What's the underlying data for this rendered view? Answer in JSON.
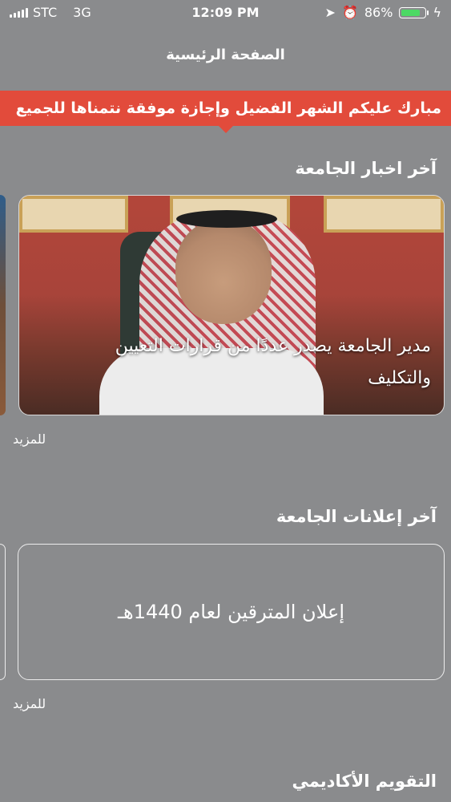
{
  "status_bar": {
    "carrier": "STC",
    "network": "3G",
    "time": "12:09 PM",
    "battery_percent": "86%",
    "battery_level": 0.86,
    "battery_color": "#4cd964"
  },
  "nav": {
    "title": "الصفحة الرئيسية"
  },
  "ticker": {
    "text": "مبارك عليكم الشهر الفضيل وإجازة موفقة نتمناها للجميع",
    "color": "#e24b3b"
  },
  "news": {
    "section_title": "آخر اخبار الجامعة",
    "cards": [
      {
        "caption": "مدير الجامعة يصدر عددًا من قرارات التعيين والتكليف"
      }
    ],
    "more_label": "للمزيد"
  },
  "announcements": {
    "section_title": "آخر إعلانات الجامعة",
    "cards": [
      {
        "text": "إعلان المترقين لعام 1440هـ"
      }
    ],
    "more_label": "للمزيد"
  },
  "calendar": {
    "section_title": "التقويم الأكاديمي"
  },
  "colors": {
    "background": "#8a8b8d",
    "accent": "#e24b3b"
  }
}
